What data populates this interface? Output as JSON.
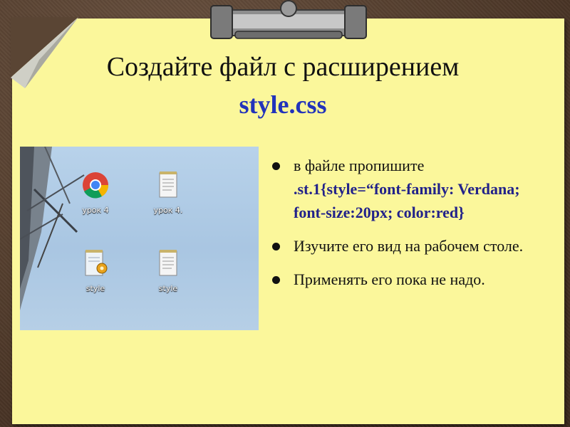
{
  "slide": {
    "title_line1": "Создайте файл с расширением",
    "title_line2": "style.css"
  },
  "desktop_icons": [
    {
      "label": "урок 4",
      "icon": "chrome-icon"
    },
    {
      "label": "урок 4.",
      "icon": "text-document-icon"
    },
    {
      "label": "style",
      "icon": "css-file-icon"
    },
    {
      "label": "style",
      "icon": "text-document-icon"
    }
  ],
  "bullets": [
    {
      "prefix": "в файле пропишите",
      "code": ".st.1{style=“font-family: Verdana; font-size:20px; color:red}"
    },
    {
      "text": "Изучите его вид на рабочем столе."
    },
    {
      "text": "Применять его пока не надо."
    }
  ],
  "colors": {
    "paper": "#fbf79b",
    "background": "#5a4534",
    "accent_text": "#2233bb"
  }
}
